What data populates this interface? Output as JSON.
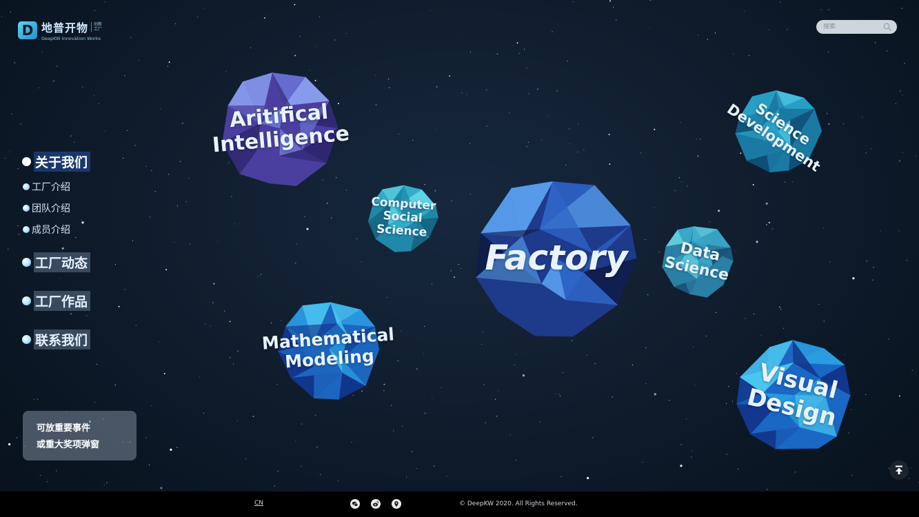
{
  "brand": {
    "name_cn": "地普开物",
    "tag_cn": "创新 工厂",
    "name_en": "DeepKW Innovation Works",
    "logo_letter": "D"
  },
  "search": {
    "placeholder": "搜索",
    "icon": "search-icon"
  },
  "nav": {
    "about": "关于我们",
    "factory_intro": "工厂介绍",
    "team_intro": "团队介绍",
    "member_intro": "成员介绍",
    "news": "工厂动态",
    "works": "工厂作品",
    "contact": "联系我们"
  },
  "notice": {
    "line1": "可放重要事件",
    "line2": "或重大奖项弹窗"
  },
  "planets": {
    "ai": {
      "line1": "Aritifical",
      "line2": "Intelligence"
    },
    "css": {
      "line1": "Computer",
      "line2": "Social Science"
    },
    "factory": {
      "line1": "Factory"
    },
    "sd": {
      "line1": "Science",
      "line2": "Development"
    },
    "ds": {
      "line1": "Data",
      "line2": "Science"
    },
    "mm": {
      "line1": "Mathematical",
      "line2": "Modeling"
    },
    "vd": {
      "line1": "Visual",
      "line2": "Design"
    }
  },
  "footer": {
    "lang": "CN",
    "copyright": "© DeepKW 2020. All Rights Reserved.",
    "icons": [
      "wechat-icon",
      "weibo-icon",
      "location-icon"
    ]
  },
  "colors": {
    "accent": "#4fc3ec",
    "background": "#0e1b2b",
    "footer": "#000000"
  }
}
